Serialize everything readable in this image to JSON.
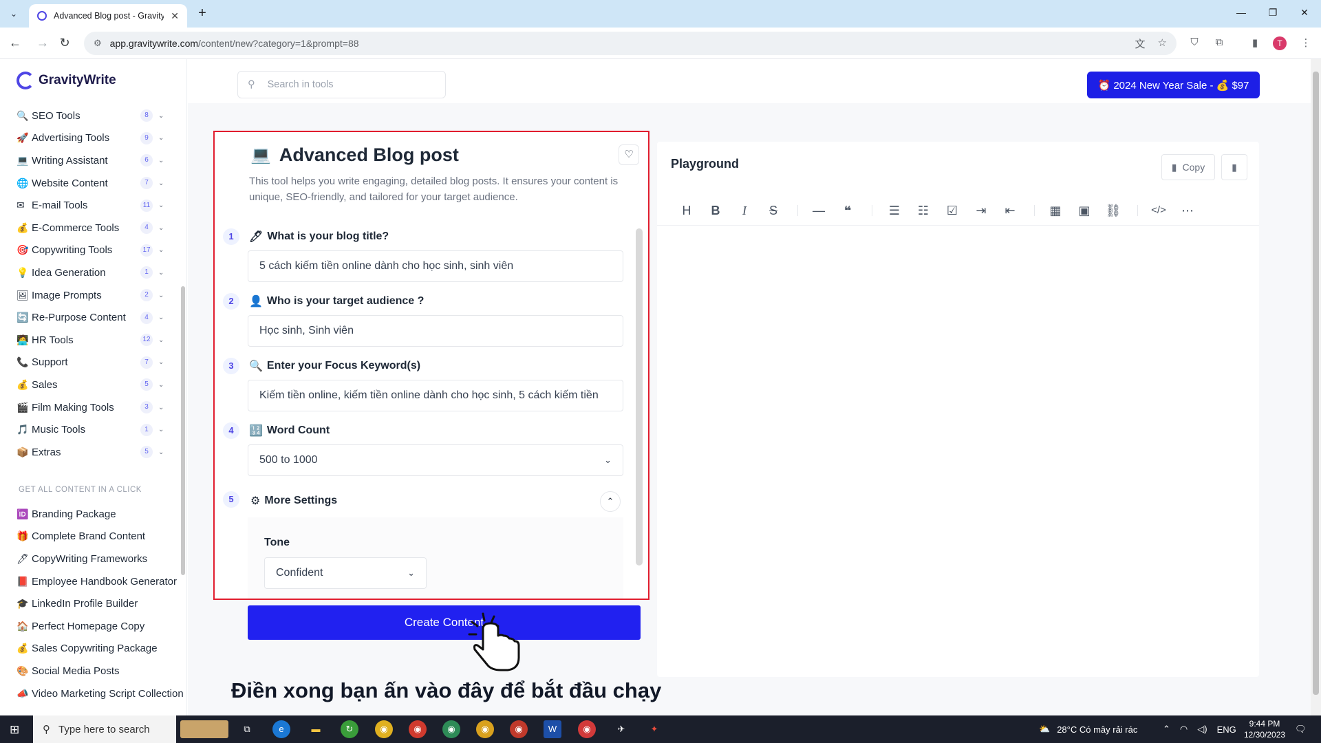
{
  "browser": {
    "tab_title": "Advanced Blog post - GravityW",
    "url_host": "app.gravitywrite.com",
    "url_path": "/content/new?category=1&prompt=88",
    "profile_initial": "T"
  },
  "app": {
    "brand": "GravityWrite",
    "search_placeholder": "Search in tools",
    "sale_button": "⏰ 2024 New Year Sale - 💰 $97"
  },
  "sidebar": {
    "categories": [
      {
        "icon": "🔍",
        "label": "SEO Tools",
        "count": "8"
      },
      {
        "icon": "🚀",
        "label": "Advertising Tools",
        "count": "9"
      },
      {
        "icon": "💻",
        "label": "Writing Assistant",
        "count": "6"
      },
      {
        "icon": "🌐",
        "label": "Website Content",
        "count": "7"
      },
      {
        "icon": "✉",
        "label": "E-mail Tools",
        "count": "11"
      },
      {
        "icon": "💰",
        "label": "E-Commerce Tools",
        "count": "4"
      },
      {
        "icon": "🎯",
        "label": "Copywriting Tools",
        "count": "17"
      },
      {
        "icon": "💡",
        "label": "Idea Generation",
        "count": "1"
      },
      {
        "icon": "🖼",
        "label": "Image Prompts",
        "count": "2"
      },
      {
        "icon": "🔄",
        "label": "Re-Purpose Content",
        "count": "4"
      },
      {
        "icon": "🧑‍💻",
        "label": "HR Tools",
        "count": "12"
      },
      {
        "icon": "📞",
        "label": "Support",
        "count": "7"
      },
      {
        "icon": "💰",
        "label": "Sales",
        "count": "5"
      },
      {
        "icon": "🎬",
        "label": "Film Making Tools",
        "count": "3"
      },
      {
        "icon": "🎵",
        "label": "Music Tools",
        "count": "1"
      },
      {
        "icon": "📦",
        "label": "Extras",
        "count": "5"
      }
    ],
    "section_title": "GET ALL CONTENT IN A CLICK",
    "packages": [
      {
        "icon": "🆔",
        "label": "Branding Package"
      },
      {
        "icon": "🎁",
        "label": "Complete Brand Content"
      },
      {
        "icon": "🖊",
        "label": "CopyWriting Frameworks"
      },
      {
        "icon": "📕",
        "label": "Employee Handbook Generator"
      },
      {
        "icon": "🎓",
        "label": "LinkedIn Profile Builder"
      },
      {
        "icon": "🏠",
        "label": "Perfect Homepage Copy"
      },
      {
        "icon": "💰",
        "label": "Sales Copywriting Package"
      },
      {
        "icon": "🎨",
        "label": "Social Media Posts"
      },
      {
        "icon": "📣",
        "label": "Video Marketing Script Collection"
      }
    ]
  },
  "tool": {
    "title": "Advanced Blog post",
    "description": "This tool helps you write engaging, detailed blog posts. It ensures your content is unique, SEO-friendly, and tailored for your target audience.",
    "steps": [
      {
        "num": "1",
        "icon": "🖊",
        "label": "What is your blog title?",
        "value": "5 cách kiếm tiền online dành cho học sinh, sinh viên"
      },
      {
        "num": "2",
        "icon": "👤",
        "label": "Who is your target audience ?",
        "value": "Học sinh, Sinh viên"
      },
      {
        "num": "3",
        "icon": "🔍",
        "label": "Enter your Focus Keyword(s)",
        "value": "Kiếm tiền online, kiếm tiền online dành cho học sinh, 5 cách kiếm tiền"
      },
      {
        "num": "4",
        "icon": "🔢",
        "label": "Word Count",
        "value": "500 to 1000"
      },
      {
        "num": "5",
        "icon": "⚙",
        "label": "More Settings",
        "value": ""
      }
    ],
    "tone_label": "Tone",
    "tone_value": "Confident",
    "create_button": "Create Content"
  },
  "annotation": "Điền xong bạn ấn vào đây để bắt đầu chạy",
  "playground": {
    "title": "Playground",
    "copy_label": "Copy"
  },
  "taskbar": {
    "search_placeholder": "Type here to search",
    "weather": "28°C  Có mây rải rác",
    "lang": "ENG",
    "time": "9:44 PM",
    "date": "12/30/2023"
  }
}
